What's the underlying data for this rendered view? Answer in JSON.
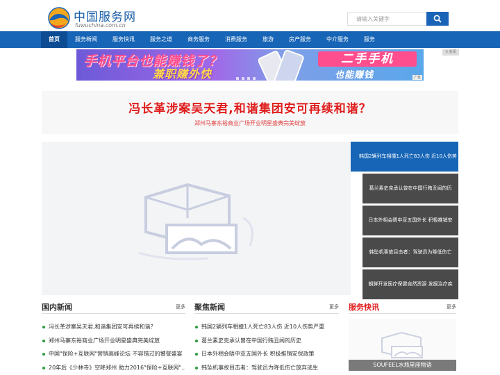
{
  "site": {
    "title": "中国服务网",
    "subtitle": "fuwuchina.com.cn"
  },
  "search": {
    "placeholder": "请输入关键字",
    "icon": "search-icon"
  },
  "nav": {
    "items": [
      {
        "label": "首页",
        "active": true
      },
      {
        "label": "服务新闻"
      },
      {
        "label": "服务快讯"
      },
      {
        "label": "服务之道"
      },
      {
        "label": "商务服务"
      },
      {
        "label": "消费服务"
      },
      {
        "label": "旅游"
      },
      {
        "label": "房产服务"
      },
      {
        "label": "中介服务"
      },
      {
        "label": "服务"
      }
    ]
  },
  "banner": {
    "line1": "手机平台也能赚钱了？",
    "line2": "兼职赚外快",
    "right1": "二手手机",
    "right2": "也能赚钱",
    "ad_tag": "广告",
    "close_label": "X 关闭"
  },
  "headline": {
    "title": "冯长革涉案吴天君,和谐集团安可再续和谐？",
    "subtitle": "郑州马寨东裕商业广场开业明星盛典完美绽放"
  },
  "slider": {
    "thumbs": [
      {
        "label": "韩国2辆列车相撞1人死亡83人伤 近10人伤势",
        "active": true
      },
      {
        "label": "葛兰素史克承认曾在中国行贿丑闻的历"
      },
      {
        "label": "日本外相会晤中亚五国外长 积极推销安"
      },
      {
        "label": "韩坠机事故目击者：驾驶员为降低伤亡"
      },
      {
        "label": "朝鲜开发医疗保健自然资源 发掘治疗疾"
      }
    ]
  },
  "columns": {
    "domestic": {
      "title": "国内新闻",
      "more": "更多",
      "items": [
        "冯长革涉案吴天君,和谐集团安可再续和谐？",
        "郑州马寨东裕商业广场开业明星盛典完美绽放",
        "中国\"保险+互联网\"营销高峰论坛 不容错过的饕餮盛宴",
        "20年后《少林寺》空降郑州 助力2016\"保险+互联网\"..."
      ]
    },
    "focus": {
      "title": "聚焦新闻",
      "more": "更多",
      "items": [
        "韩国2辆列车相撞1人死亡83人伤 近10人伤势严重",
        "葛兰素史克承认曾在中国行贿丑闻的历史",
        "日本外相会晤中亚五国外长 积极推销安保政策",
        "韩坠机事故目击者：驾驶员为降低伤亡放弃逃生"
      ]
    },
    "quick": {
      "title": "服务快讯",
      "more": "更多",
      "caption": "SOUFEEL水瓶星座物语"
    }
  },
  "colors": {
    "brand_blue": "#1765b6",
    "headline_red": "#e01c1c",
    "bullet_green": "#2e9a3e"
  }
}
